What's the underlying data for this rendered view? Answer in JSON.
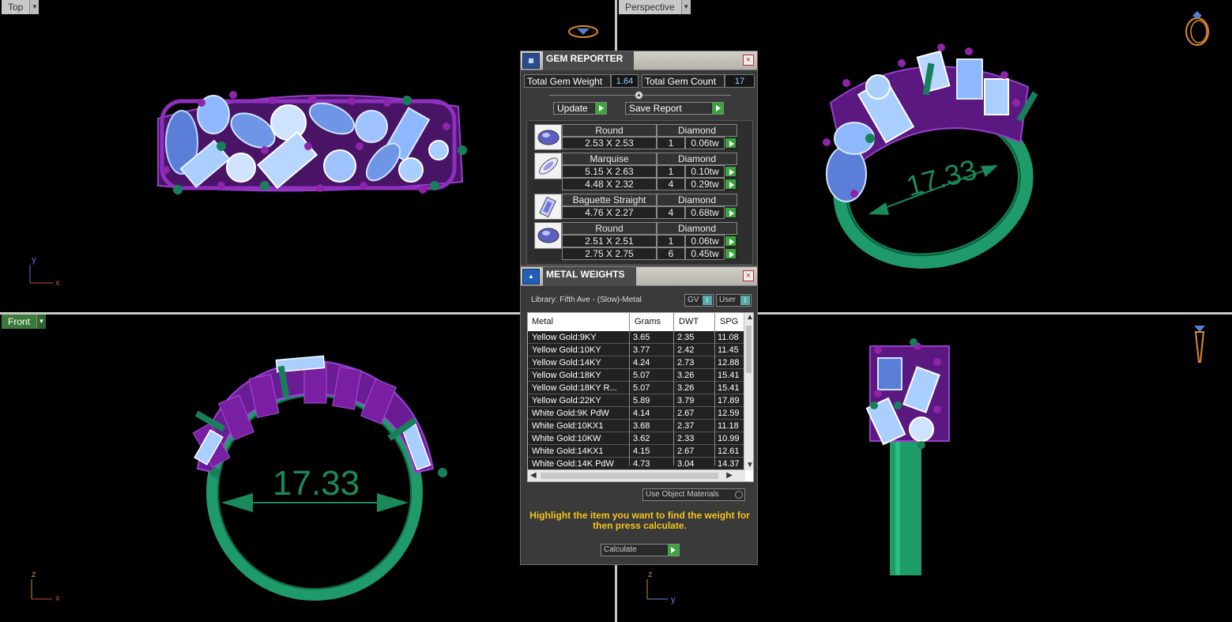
{
  "viewports": {
    "top": {
      "label": "Top",
      "axes": [
        "y",
        "x"
      ]
    },
    "perspective": {
      "label": "Perspective"
    },
    "front": {
      "label": "Front",
      "axes": [
        "z",
        "x"
      ],
      "dimension": "17.33"
    },
    "right": {
      "axes": [
        "z",
        "y"
      ]
    },
    "perspective_dimension": "17.33"
  },
  "gem_reporter": {
    "title": "GEM REPORTER",
    "total_weight_label": "Total Gem Weight",
    "total_weight_value": "1.64",
    "total_count_label": "Total Gem Count",
    "total_count_value": "17",
    "update_label": "Update",
    "save_label": "Save Report",
    "gems": [
      {
        "shape": "Round",
        "material": "Diamond",
        "rows": [
          {
            "size": "2.53 X 2.53",
            "count": "1",
            "weight": "0.06tw"
          }
        ]
      },
      {
        "shape": "Marquise",
        "material": "Diamond",
        "rows": [
          {
            "size": "5.15 X 2.63",
            "count": "1",
            "weight": "0.10tw"
          },
          {
            "size": "4.48 X 2.32",
            "count": "4",
            "weight": "0.29tw"
          }
        ]
      },
      {
        "shape": "Baguette Straight",
        "material": "Diamond",
        "rows": [
          {
            "size": "4.76 X 2.27",
            "count": "4",
            "weight": "0.68tw"
          }
        ]
      },
      {
        "shape": "Round",
        "material": "Diamond",
        "rows": [
          {
            "size": "2.51 X 2.51",
            "count": "1",
            "weight": "0.06tw"
          },
          {
            "size": "2.75 X 2.75",
            "count": "6",
            "weight": "0.45tw"
          }
        ]
      }
    ]
  },
  "metal_weights": {
    "title": "METAL WEIGHTS",
    "library": "Library: Fifth Ave - (Slow)-Metal",
    "gv_label": "GV",
    "user_label": "User",
    "columns": [
      "Metal",
      "Grams",
      "DWT",
      "SPG"
    ],
    "rows": [
      [
        "Yellow Gold:9KY",
        "3.65",
        "2.35",
        "11.08"
      ],
      [
        "Yellow Gold:10KY",
        "3.77",
        "2.42",
        "11.45"
      ],
      [
        "Yellow Gold:14KY",
        "4.24",
        "2.73",
        "12.88"
      ],
      [
        "Yellow Gold:18KY",
        "5.07",
        "3.26",
        "15.41"
      ],
      [
        "Yellow Gold:18KY R...",
        "5.07",
        "3.26",
        "15.41"
      ],
      [
        "Yellow Gold:22KY",
        "5.89",
        "3.79",
        "17.89"
      ],
      [
        "White Gold:9K PdW",
        "4.14",
        "2.67",
        "12.59"
      ],
      [
        "White Gold:10KX1",
        "3.68",
        "2.37",
        "11.18"
      ],
      [
        "White Gold:10KW",
        "3.62",
        "2.33",
        "10.99"
      ],
      [
        "White Gold:14KX1",
        "4.15",
        "2.67",
        "12.61"
      ],
      [
        "White Gold:14K PdW",
        "4.73",
        "3.04",
        "14.37"
      ]
    ],
    "use_object_materials": "Use Object Materials",
    "hint": "Highlight the item you want to find the weight for then press calculate.",
    "calculate_label": "Calculate"
  },
  "colors": {
    "metal_purple": "#7b1fa2",
    "gem_blue": "#a8cfff",
    "shank_green": "#1f9a6a",
    "dim_green": "#1a8a5a"
  }
}
